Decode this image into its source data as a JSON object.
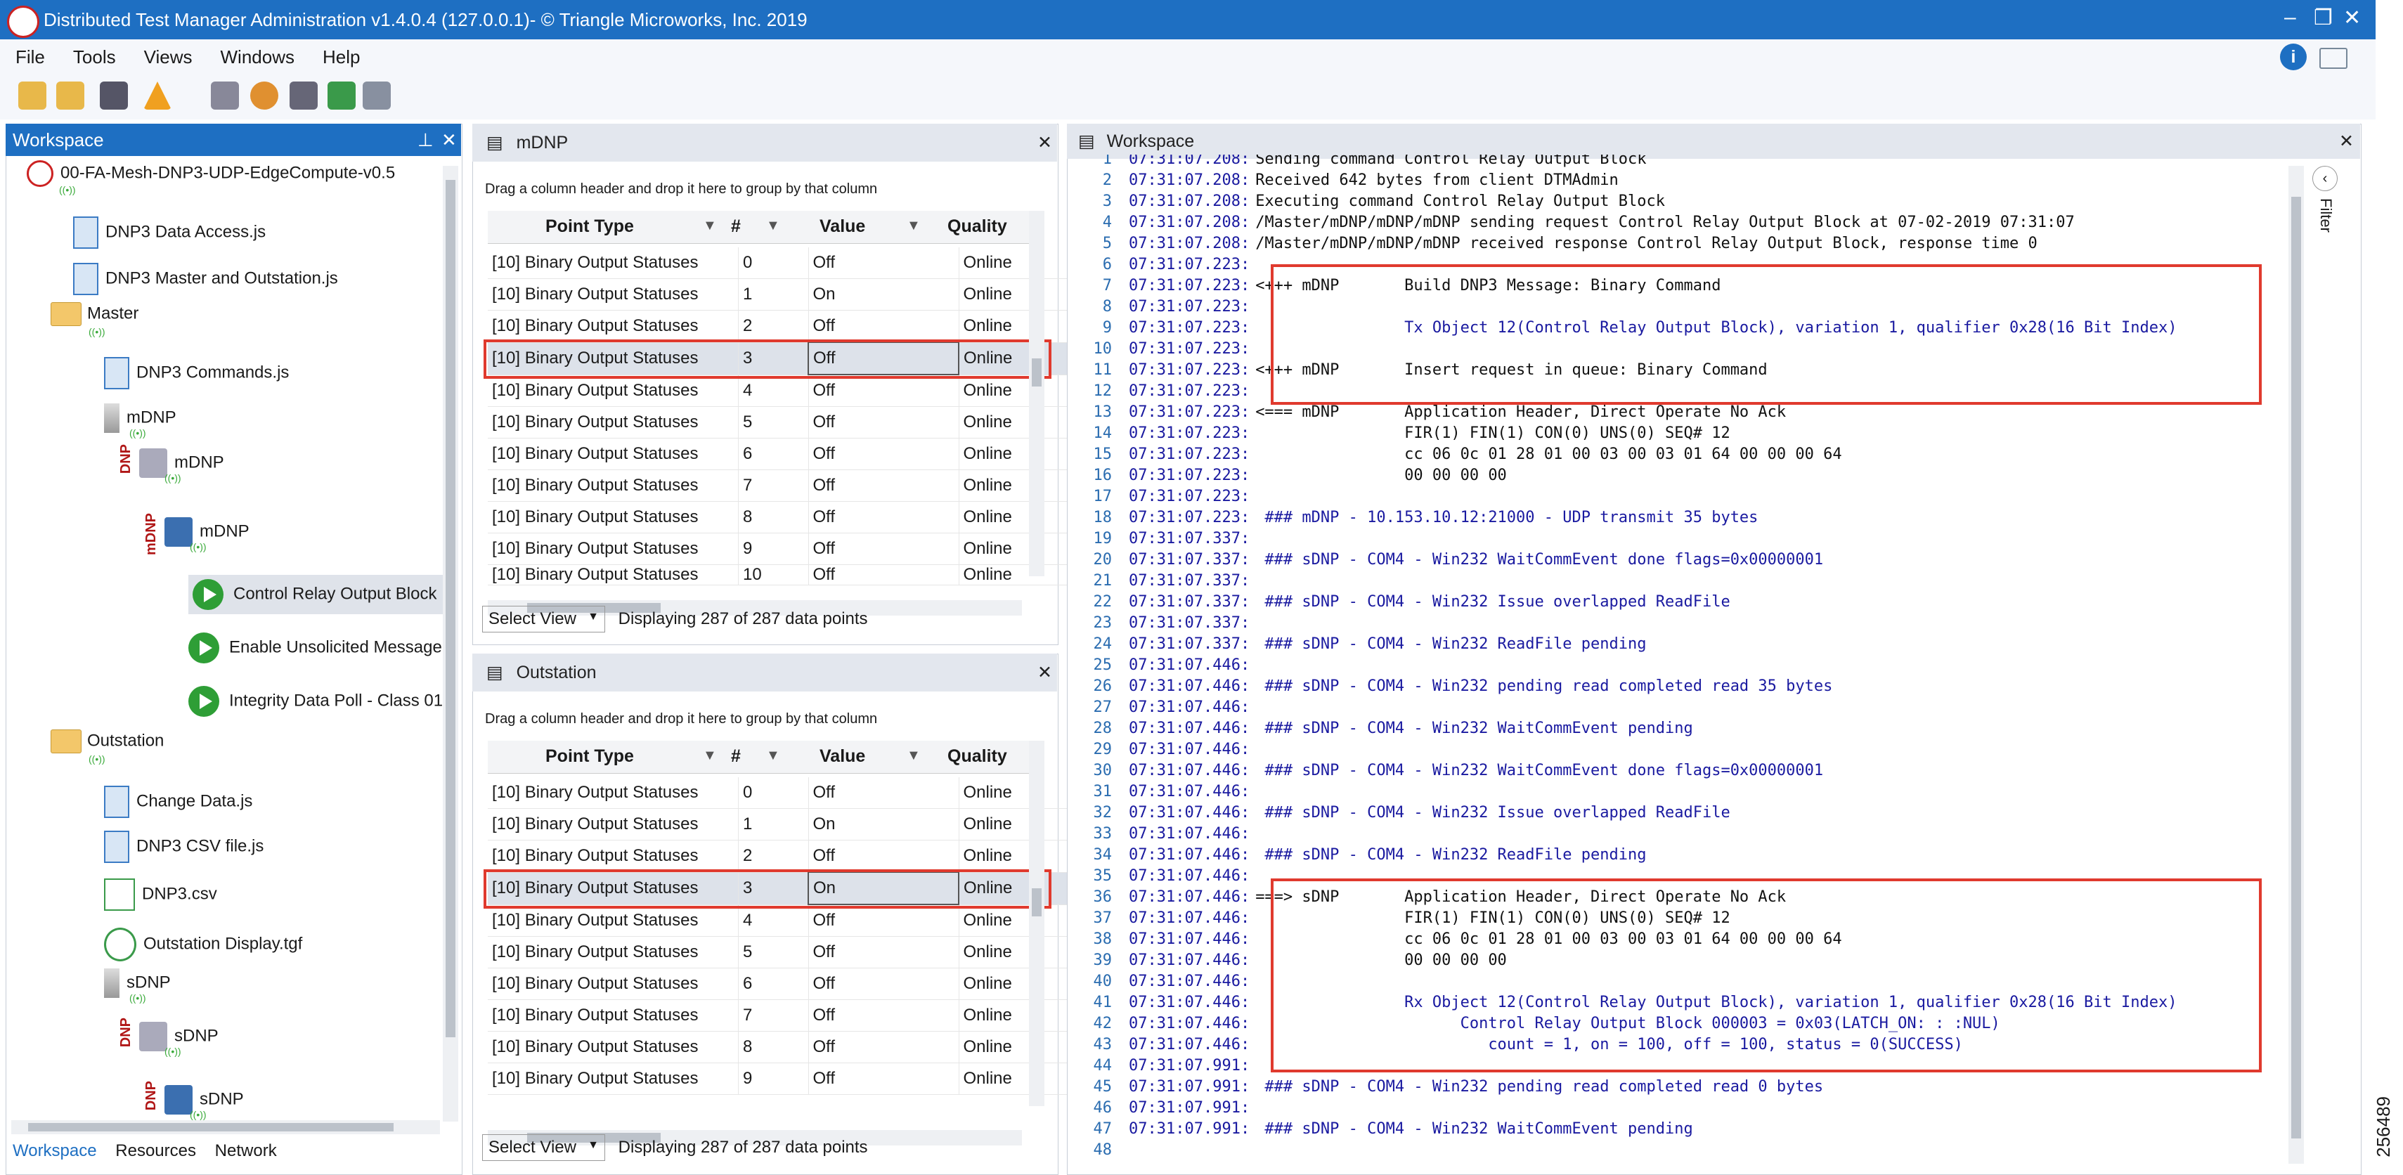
{
  "app": {
    "title": "Distributed Test Manager Administration v1.4.0.4 (127.0.0.1)- © Triangle Microworks, Inc. 2019",
    "menu": [
      "File",
      "Tools",
      "Views",
      "Windows",
      "Help"
    ]
  },
  "workspace_panel": {
    "title": "Workspace",
    "tree": [
      {
        "label": "00-FA-Mesh-DNP3-UDP-EdgeCompute-v0.5",
        "icon": "workspace-icon"
      },
      {
        "label": "DNP3 Data Access.js",
        "icon": "script-icon"
      },
      {
        "label": "DNP3 Master and Outstation.js",
        "icon": "script-icon"
      },
      {
        "label": "Master",
        "icon": "folder-icon"
      },
      {
        "label": "DNP3 Commands.js",
        "icon": "script-icon"
      },
      {
        "label": "mDNP",
        "icon": "device-icon"
      },
      {
        "label": "mDNP",
        "icon": "channel-icon",
        "tag": "DNP"
      },
      {
        "label": "mDNP",
        "icon": "session-icon",
        "tag": "mDNP"
      },
      {
        "label": "Control Relay Output Block",
        "icon": "play-icon"
      },
      {
        "label": "Enable Unsolicited Message:",
        "icon": "play-icon"
      },
      {
        "label": "Integrity Data Poll - Class 01",
        "icon": "play-icon"
      },
      {
        "label": "Outstation",
        "icon": "folder-icon"
      },
      {
        "label": "Change Data.js",
        "icon": "script-icon"
      },
      {
        "label": "DNP3 CSV file.js",
        "icon": "script-icon"
      },
      {
        "label": "DNP3.csv",
        "icon": "csv-icon"
      },
      {
        "label": "Outstation Display.tgf",
        "icon": "display-icon"
      },
      {
        "label": "sDNP",
        "icon": "device-icon"
      },
      {
        "label": "sDNP",
        "icon": "channel-icon",
        "tag": "DNP"
      },
      {
        "label": "sDNP",
        "icon": "session-icon",
        "tag": "DNP"
      }
    ],
    "tabs": [
      "Workspace",
      "Resources",
      "Network"
    ]
  },
  "mdnp_grid": {
    "title": "mDNP",
    "group_hint": "Drag a column header and drop it here to group by that column",
    "columns": [
      "Point Type",
      "#",
      "Value",
      "Quality"
    ],
    "rows": [
      [
        "[10] Binary Output Statuses",
        "0",
        "Off",
        "Online"
      ],
      [
        "[10] Binary Output Statuses",
        "1",
        "On",
        "Online"
      ],
      [
        "[10] Binary Output Statuses",
        "2",
        "Off",
        "Online"
      ],
      [
        "[10] Binary Output Statuses",
        "3",
        "Off",
        "Online"
      ],
      [
        "[10] Binary Output Statuses",
        "4",
        "Off",
        "Online"
      ],
      [
        "[10] Binary Output Statuses",
        "5",
        "Off",
        "Online"
      ],
      [
        "[10] Binary Output Statuses",
        "6",
        "Off",
        "Online"
      ],
      [
        "[10] Binary Output Statuses",
        "7",
        "Off",
        "Online"
      ],
      [
        "[10] Binary Output Statuses",
        "8",
        "Off",
        "Online"
      ],
      [
        "[10] Binary Output Statuses",
        "9",
        "Off",
        "Online"
      ],
      [
        "[10] Binary Output Statuses",
        "10",
        "Off",
        "Online"
      ]
    ],
    "select_view": "Select View",
    "status": "Displaying 287 of 287 data points"
  },
  "outstation_grid": {
    "title": "Outstation",
    "group_hint": "Drag a column header and drop it here to group by that column",
    "columns": [
      "Point Type",
      "#",
      "Value",
      "Quality"
    ],
    "rows": [
      [
        "[10] Binary Output Statuses",
        "0",
        "Off",
        "Online"
      ],
      [
        "[10] Binary Output Statuses",
        "1",
        "On",
        "Online"
      ],
      [
        "[10] Binary Output Statuses",
        "2",
        "Off",
        "Online"
      ],
      [
        "[10] Binary Output Statuses",
        "3",
        "On",
        "Online"
      ],
      [
        "[10] Binary Output Statuses",
        "4",
        "Off",
        "Online"
      ],
      [
        "[10] Binary Output Statuses",
        "5",
        "Off",
        "Online"
      ],
      [
        "[10] Binary Output Statuses",
        "6",
        "Off",
        "Online"
      ],
      [
        "[10] Binary Output Statuses",
        "7",
        "Off",
        "Online"
      ],
      [
        "[10] Binary Output Statuses",
        "8",
        "Off",
        "Online"
      ],
      [
        "[10] Binary Output Statuses",
        "9",
        "Off",
        "Online"
      ]
    ],
    "select_view": "Select View",
    "status": "Displaying 287 of 287 data points"
  },
  "log_panel": {
    "title": "Workspace",
    "filter_label": "Filter",
    "side_number": "256489",
    "lines": [
      {
        "n": "1",
        "t": "07:31:07.208:",
        "m": "Sending command Control Relay Output Block",
        "c": "black"
      },
      {
        "n": "2",
        "t": "07:31:07.208:",
        "m": "Received 642 bytes from client DTMAdmin",
        "c": "black"
      },
      {
        "n": "3",
        "t": "07:31:07.208:",
        "m": "Executing command Control Relay Output Block",
        "c": "black"
      },
      {
        "n": "4",
        "t": "07:31:07.208:",
        "m": "/Master/mDNP/mDNP/mDNP sending request Control Relay Output Block at 07-02-2019 07:31:07",
        "c": "black"
      },
      {
        "n": "5",
        "t": "07:31:07.208:",
        "m": "/Master/mDNP/mDNP/mDNP received response Control Relay Output Block, response time 0",
        "c": "black"
      },
      {
        "n": "6",
        "t": "07:31:07.223:",
        "m": "",
        "c": "black"
      },
      {
        "n": "7",
        "t": "07:31:07.223:",
        "m": "<+++ mDNP       Build DNP3 Message: Binary Command",
        "c": "black"
      },
      {
        "n": "8",
        "t": "07:31:07.223:",
        "m": "",
        "c": "blue"
      },
      {
        "n": "9",
        "t": "07:31:07.223:",
        "m": "                Tx Object 12(Control Relay Output Block), variation 1, qualifier 0x28(16 Bit Index)",
        "c": "blue"
      },
      {
        "n": "10",
        "t": "07:31:07.223:",
        "m": "",
        "c": "black"
      },
      {
        "n": "11",
        "t": "07:31:07.223:",
        "m": "<+++ mDNP       Insert request in queue: Binary Command",
        "c": "black"
      },
      {
        "n": "12",
        "t": "07:31:07.223:",
        "m": "",
        "c": "black"
      },
      {
        "n": "13",
        "t": "07:31:07.223:",
        "m": "<=== mDNP       Application Header, Direct Operate No Ack",
        "c": "black"
      },
      {
        "n": "14",
        "t": "07:31:07.223:",
        "m": "                FIR(1) FIN(1) CON(0) UNS(0) SEQ# 12",
        "c": "black"
      },
      {
        "n": "15",
        "t": "07:31:07.223:",
        "m": "                cc 06 0c 01 28 01 00 03 00 03 01 64 00 00 00 64",
        "c": "black"
      },
      {
        "n": "16",
        "t": "07:31:07.223:",
        "m": "                00 00 00 00",
        "c": "black"
      },
      {
        "n": "17",
        "t": "07:31:07.223:",
        "m": "",
        "c": "black"
      },
      {
        "n": "18",
        "t": "07:31:07.223:",
        "m": " ### mDNP - 10.153.10.12:21000 - UDP transmit 35 bytes",
        "c": "blue"
      },
      {
        "n": "19",
        "t": "07:31:07.337:",
        "m": "",
        "c": "black"
      },
      {
        "n": "20",
        "t": "07:31:07.337:",
        "m": " ### sDNP - COM4 - Win232 WaitCommEvent done flags=0x00000001",
        "c": "blue"
      },
      {
        "n": "21",
        "t": "07:31:07.337:",
        "m": "",
        "c": "black"
      },
      {
        "n": "22",
        "t": "07:31:07.337:",
        "m": " ### sDNP - COM4 - Win232 Issue overlapped ReadFile",
        "c": "blue"
      },
      {
        "n": "23",
        "t": "07:31:07.337:",
        "m": "",
        "c": "black"
      },
      {
        "n": "24",
        "t": "07:31:07.337:",
        "m": " ### sDNP - COM4 - Win232 ReadFile pending",
        "c": "blue"
      },
      {
        "n": "25",
        "t": "07:31:07.446:",
        "m": "",
        "c": "black"
      },
      {
        "n": "26",
        "t": "07:31:07.446:",
        "m": " ### sDNP - COM4 - Win232 pending read completed read 35 bytes",
        "c": "blue"
      },
      {
        "n": "27",
        "t": "07:31:07.446:",
        "m": "",
        "c": "black"
      },
      {
        "n": "28",
        "t": "07:31:07.446:",
        "m": " ### sDNP - COM4 - Win232 WaitCommEvent pending",
        "c": "blue"
      },
      {
        "n": "29",
        "t": "07:31:07.446:",
        "m": "",
        "c": "black"
      },
      {
        "n": "30",
        "t": "07:31:07.446:",
        "m": " ### sDNP - COM4 - Win232 WaitCommEvent done flags=0x00000001",
        "c": "blue"
      },
      {
        "n": "31",
        "t": "07:31:07.446:",
        "m": "",
        "c": "black"
      },
      {
        "n": "32",
        "t": "07:31:07.446:",
        "m": " ### sDNP - COM4 - Win232 Issue overlapped ReadFile",
        "c": "blue"
      },
      {
        "n": "33",
        "t": "07:31:07.446:",
        "m": "",
        "c": "black"
      },
      {
        "n": "34",
        "t": "07:31:07.446:",
        "m": " ### sDNP - COM4 - Win232 ReadFile pending",
        "c": "blue"
      },
      {
        "n": "35",
        "t": "07:31:07.446:",
        "m": "",
        "c": "black"
      },
      {
        "n": "36",
        "t": "07:31:07.446:",
        "m": "===> sDNP       Application Header, Direct Operate No Ack",
        "c": "black"
      },
      {
        "n": "37",
        "t": "07:31:07.446:",
        "m": "                FIR(1) FIN(1) CON(0) UNS(0) SEQ# 12",
        "c": "black"
      },
      {
        "n": "38",
        "t": "07:31:07.446:",
        "m": "                cc 06 0c 01 28 01 00 03 00 03 01 64 00 00 00 64",
        "c": "black"
      },
      {
        "n": "39",
        "t": "07:31:07.446:",
        "m": "                00 00 00 00",
        "c": "black"
      },
      {
        "n": "40",
        "t": "07:31:07.446:",
        "m": "",
        "c": "blue"
      },
      {
        "n": "41",
        "t": "07:31:07.446:",
        "m": "                Rx Object 12(Control Relay Output Block), variation 1, qualifier 0x28(16 Bit Index)",
        "c": "blue"
      },
      {
        "n": "42",
        "t": "07:31:07.446:",
        "m": "                      Control Relay Output Block 000003 = 0x03(LATCH_ON: : :NUL)",
        "c": "blue"
      },
      {
        "n": "43",
        "t": "07:31:07.446:",
        "m": "                         count = 1, on = 100, off = 100, status = 0(SUCCESS)",
        "c": "blue"
      },
      {
        "n": "44",
        "t": "07:31:07.991:",
        "m": "",
        "c": "black"
      },
      {
        "n": "45",
        "t": "07:31:07.991:",
        "m": " ### sDNP - COM4 - Win232 pending read completed read 0 bytes",
        "c": "blue"
      },
      {
        "n": "46",
        "t": "07:31:07.991:",
        "m": "",
        "c": "black"
      },
      {
        "n": "47",
        "t": "07:31:07.991:",
        "m": " ### sDNP - COM4 - Win232 WaitCommEvent pending",
        "c": "blue"
      },
      {
        "n": "48",
        "t": "",
        "m": "",
        "c": "black"
      }
    ]
  },
  "colors": {
    "title_bar": "#1e6fc2",
    "highlight_box": "#e03a2e",
    "log_blue": "#1a1aa0",
    "play_green": "#2e9e36"
  }
}
